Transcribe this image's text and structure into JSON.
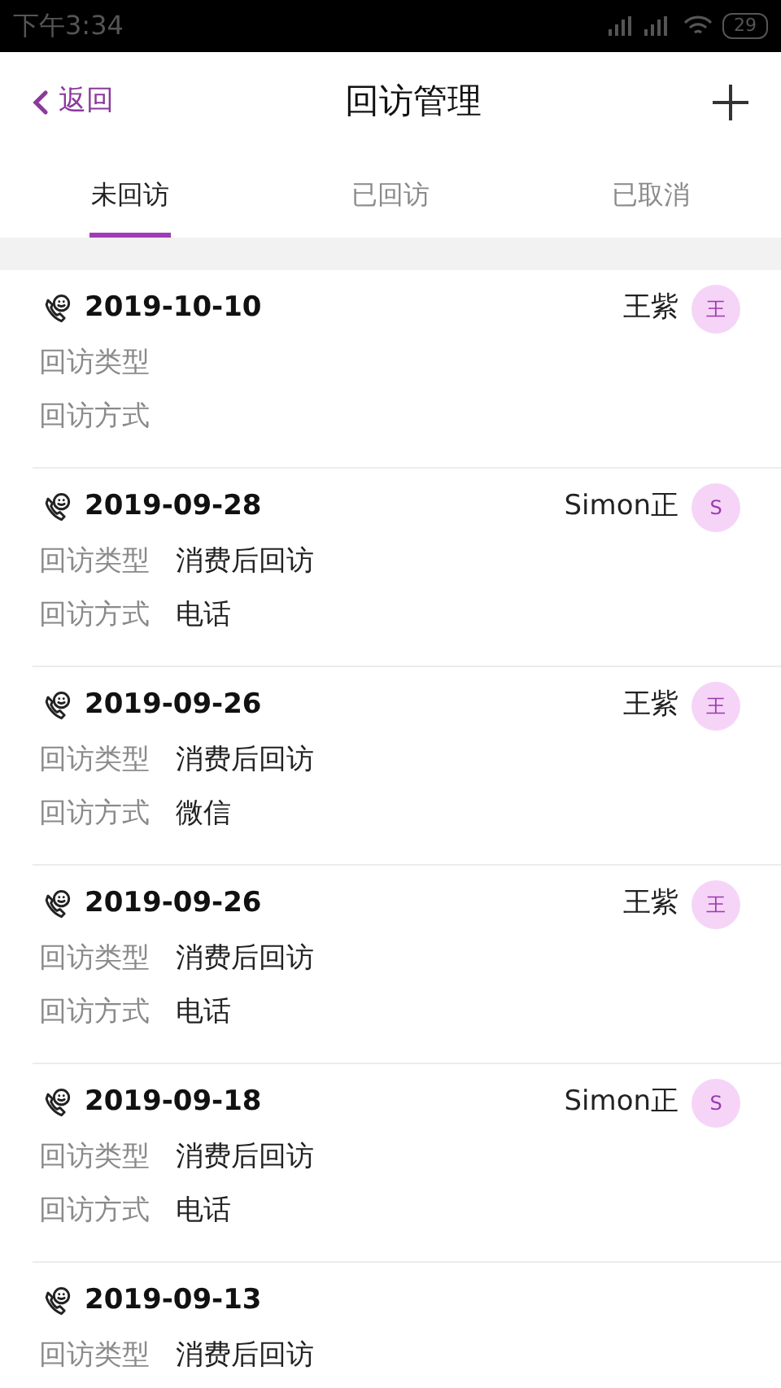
{
  "status_bar": {
    "time": "下午3:34",
    "battery": "29"
  },
  "header": {
    "back": "返回",
    "title": "回访管理"
  },
  "tabs": [
    {
      "label": "未回访",
      "selected": true
    },
    {
      "label": "已回访",
      "selected": false
    },
    {
      "label": "已取消",
      "selected": false
    }
  ],
  "records": [
    {
      "date": "2019-10-10",
      "name": "王紫",
      "avatar": "王",
      "type_label": "回访类型",
      "method_label": "回访方式"
    },
    {
      "date": "2019-09-28",
      "name": "Simon正",
      "avatar": "S",
      "type_label": "回访类型",
      "type": "消费后回访",
      "method_label": "回访方式",
      "method": "电话"
    },
    {
      "date": "2019-09-26",
      "name": "王紫",
      "avatar": "王",
      "type_label": "回访类型",
      "type": "消费后回访",
      "method_label": "回访方式",
      "method": "微信"
    },
    {
      "date": "2019-09-26",
      "name": "王紫",
      "avatar": "王",
      "type_label": "回访类型",
      "type": "消费后回访",
      "method_label": "回访方式",
      "method": "电话"
    },
    {
      "date": "2019-09-18",
      "name": "Simon正",
      "avatar": "S",
      "type_label": "回访类型",
      "type": "消费后回访",
      "method_label": "回访方式",
      "method": "电话"
    },
    {
      "date": "2019-09-13",
      "type_label": "回访类型",
      "type": "消费后回访"
    }
  ]
}
